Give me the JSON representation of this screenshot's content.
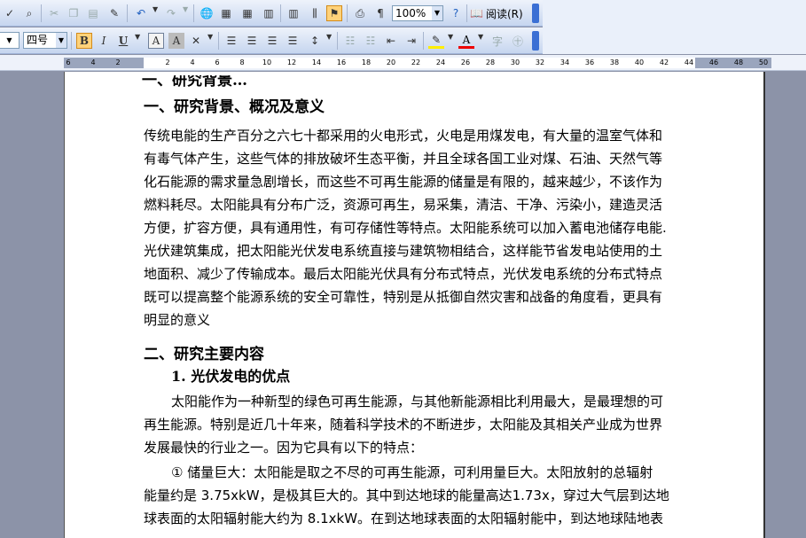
{
  "toolbar": {
    "zoom": "100%",
    "read_label": "阅读(R)",
    "font_size": "四号",
    "bold": "B",
    "italic": "I",
    "underline": "U",
    "char_border": "A",
    "char_shade": "A",
    "font_color": "A"
  },
  "ruler": {
    "labels": [
      "6",
      "4",
      "2",
      "2",
      "4",
      "6",
      "8",
      "10",
      "12",
      "14",
      "16",
      "18",
      "20",
      "22",
      "24",
      "26",
      "28",
      "30",
      "32",
      "34",
      "36",
      "38",
      "40",
      "42",
      "44",
      "46",
      "48",
      "50"
    ]
  },
  "document": {
    "cutoff_heading": "一、研究背景…",
    "section1_heading": "一、研究背景、概况及意义",
    "section1_lines": [
      " 传统电能的生产百分之六七十都采用的火电形式，火电是用煤发电，有大量的温室气体和",
      "有毒气体产生，这些气体的排放破坏生态平衡，并且全球各国工业对煤、石油、天然气等",
      "化石能源的需求量急剧增长，而这些不可再生能源的储量是有限的，越来越少，不该作为",
      "燃料耗尽。太阳能具有分布广泛，资源可再生，易采集，清洁、干净、污染小，建造灵活",
      "方便，扩容方便，具有通用性，有可存储性等特点。太阳能系统可以加入蓄电池储存电能.",
      "光伏建筑集成，把太阳能光伏发电系统直接与建筑物相结合，这样能节省发电站使用的土",
      "地面积、减少了传输成本。最后太阳能光伏具有分布式特点，光伏发电系统的分布式特点",
      "既可以提高整个能源系统的安全可靠性，特别是从抵御自然灾害和战备的角度看，更具有",
      "明显的意义"
    ],
    "section2_heading": "二、研究主要内容",
    "subsection1_heading": "1. 光伏发电的优点",
    "section2_lines": [
      "太阳能作为一种新型的绿色可再生能源，与其他新能源相比利用最大，是最理想的可",
      "再生能源。特别是近几十年来，随着科学技术的不断进步，太阳能及其相关产业成为世界",
      "发展最快的行业之一。因为它具有以下的特点：",
      "①  储量巨大：太阳能是取之不尽的可再生能源，可利用量巨大。太阳放射的总辐射",
      "能量约是  3.75xkW，是极其巨大的。其中到达地球的能量高达1.73x，穿过大气层到达地",
      "球表面的太阳辐射能大约为  8.1xkW。在到达地球表面的太阳辐射能中，到达地球陆地表"
    ]
  }
}
